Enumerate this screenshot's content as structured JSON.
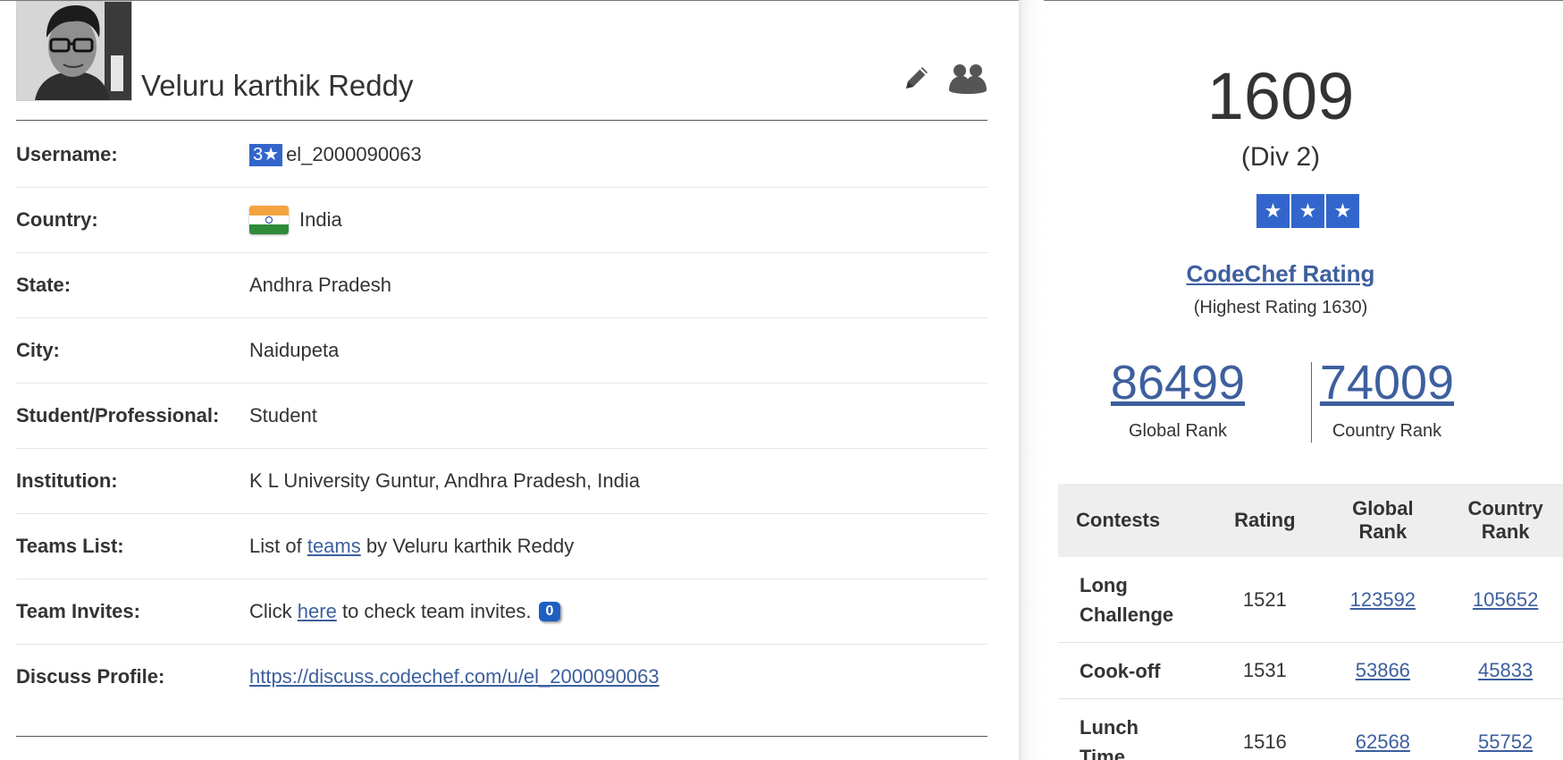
{
  "profile": {
    "name": "Veluru karthik Reddy"
  },
  "info": {
    "username": {
      "label": "Username:",
      "badge": "3★",
      "value": "el_2000090063"
    },
    "country": {
      "label": "Country:",
      "value": "India"
    },
    "state": {
      "label": "State:",
      "value": "Andhra Pradesh"
    },
    "city": {
      "label": "City:",
      "value": "Naidupeta"
    },
    "student_professional": {
      "label": "Student/Professional:",
      "value": "Student"
    },
    "institution": {
      "label": "Institution:",
      "value": "K L University Guntur, Andhra Pradesh, India"
    },
    "teams_list": {
      "label": "Teams List:",
      "prefix": "List of",
      "link": "teams",
      "suffix": "by Veluru karthik Reddy"
    },
    "team_invites": {
      "label": "Team Invites:",
      "prefix": "Click",
      "link": "here",
      "suffix": "to check team invites.",
      "count": "0"
    },
    "discuss_profile": {
      "label": "Discuss Profile:",
      "link": "https://discuss.codechef.com/u/el_2000090063"
    }
  },
  "rating": {
    "value": "1609",
    "division": "(Div 2)",
    "stars": [
      "★",
      "★",
      "★"
    ],
    "title": "CodeChef Rating",
    "highest": "(Highest Rating 1630)",
    "global_rank": "86499",
    "global_rank_label": "Global Rank",
    "country_rank": "74009",
    "country_rank_label": "Country Rank"
  },
  "contests_table": {
    "headers": {
      "contests": "Contests",
      "rating": "Rating",
      "global_rank_line1": "Global",
      "global_rank_line2": "Rank",
      "country_rank_line1": "Country",
      "country_rank_line2": "Rank"
    },
    "rows": [
      {
        "name_line1": "Long",
        "name_line2": "Challenge",
        "rating": "1521",
        "global_rank": "123592",
        "country_rank": "105652"
      },
      {
        "name_line1": "Cook-off",
        "name_line2": "",
        "rating": "1531",
        "global_rank": "53866",
        "country_rank": "45833"
      },
      {
        "name_line1": "Lunch",
        "name_line2": "Time",
        "rating": "1516",
        "global_rank": "62568",
        "country_rank": "55752"
      }
    ]
  },
  "icons": {
    "edit": "pencil-icon",
    "teams": "teams-icon",
    "flag": "india-flag-icon"
  },
  "colors": {
    "accent_blue": "#3366cc",
    "link": "#3d5f9e",
    "invite_badge": "#1f5fbf"
  }
}
